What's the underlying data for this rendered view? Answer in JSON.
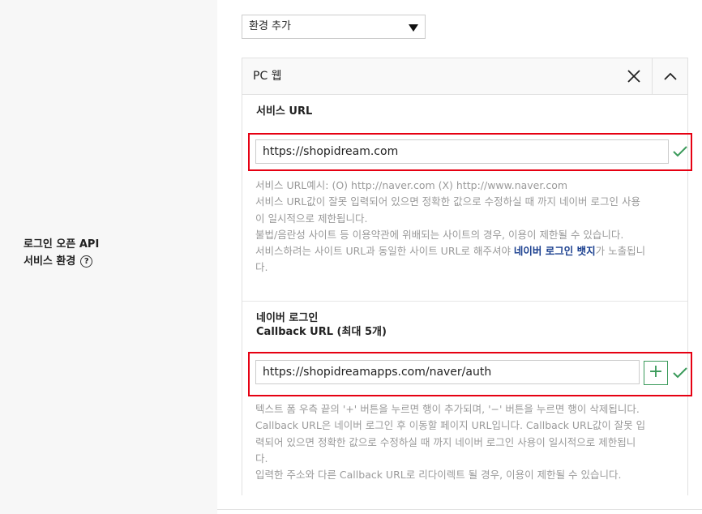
{
  "section": {
    "label_line1": "로그인 오픈 API",
    "label_line2": "서비스 환경",
    "help_symbol": "?"
  },
  "env_select": {
    "value": "환경 추가",
    "icon": "caret-down-icon"
  },
  "panel": {
    "title": "PC 웹",
    "close_icon": "close-icon",
    "collapse_icon": "chevron-up-icon"
  },
  "service_url": {
    "label": "서비스 URL",
    "value": "https://shopidream.com",
    "status_icon": "check-icon",
    "help": [
      "서비스 URL예시: (O) http://naver.com (X) http://www.naver.com",
      "서비스 URL값이 잘못 입력되어 있으면 정확한 값으로 수정하실 때 까지 네이버 로그인 사용",
      "이 일시적으로 제한됩니다.",
      "불법/음란성 사이트 등 이용약관에 위배되는 사이트의 경우, 이용이 제한될 수 있습니다."
    ],
    "help_badge_pre": "서비스하려는 사이트 URL과 동일한 사이트 URL로 해주셔야 ",
    "help_badge_link": "네이버 로그인 뱃지",
    "help_badge_post": "가 노출됩니",
    "help_badge_tail": "다."
  },
  "callback_url": {
    "label_line1": "네이버 로그인",
    "label_line2": "Callback URL (최대 5개)",
    "value": "https://shopidreamapps.com/naver/auth",
    "add_label": "+",
    "status_icon": "check-icon",
    "help": [
      "텍스트 폼 우측 끝의 '+' 버튼을 누르면 행이 추가되며, '−' 버튼을 누르면 행이 삭제됩니다.",
      "Callback URL은 네이버 로그인 후 이동할 페이지 URL입니다. Callback URL값이 잘못 입",
      "력되어 있으면 정확한 값으로 수정하실 때 까지 네이버 로그인 사용이 일시적으로 제한됩니",
      "다.",
      "입력한 주소와 다른 Callback URL로 리다이렉트 될 경우, 이용이 제한될 수 있습니다."
    ]
  },
  "colors": {
    "highlight_border": "#e60012",
    "check_green": "#3a9a5a",
    "link_blue": "#1a3f8f"
  }
}
